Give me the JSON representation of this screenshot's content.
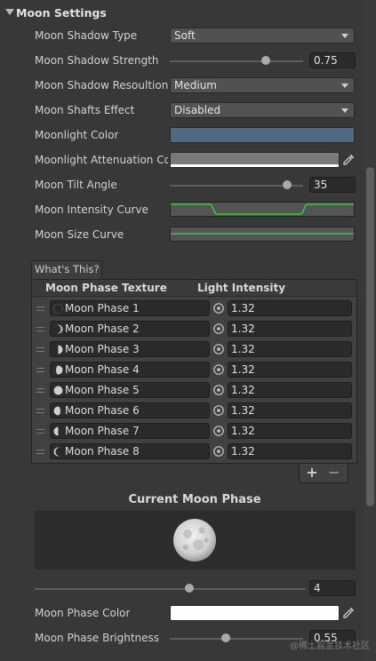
{
  "section": {
    "title": "Moon Settings"
  },
  "settings": {
    "shadow_type": {
      "label": "Moon Shadow Type",
      "value": "Soft"
    },
    "shadow_strength": {
      "label": "Moon Shadow Strength",
      "value": "0.75",
      "fraction": 0.75
    },
    "shadow_resolution": {
      "label": "Moon Shadow Resoultion",
      "value": "Medium"
    },
    "shafts_effect": {
      "label": "Moon Shafts Effect",
      "value": "Disabled"
    },
    "moonlight_color": {
      "label": "Moonlight Color",
      "color": "#4f6a80"
    },
    "attenuation_color": {
      "label": "Moonlight Attenuation Color",
      "color": "#7a7a7a"
    },
    "tilt_angle": {
      "label": "Moon Tilt Angle",
      "value": "35"
    },
    "intensity_curve": {
      "label": "Moon Intensity Curve",
      "curve_color": "#3fd23f"
    },
    "size_curve": {
      "label": "Moon Size Curve",
      "curve_color": "#3fd23f"
    }
  },
  "phases_list": {
    "tab_label": "What's This?",
    "columns": [
      "Moon Phase Texture",
      "Light Intensity"
    ],
    "rows": [
      {
        "texture": "Moon Phase 1",
        "intensity": "1.32",
        "lit": "new"
      },
      {
        "texture": "Moon Phase 2",
        "intensity": "1.32",
        "lit": "waxing-crescent"
      },
      {
        "texture": "Moon Phase 3",
        "intensity": "1.32",
        "lit": "first-quarter"
      },
      {
        "texture": "Moon Phase 4",
        "intensity": "1.32",
        "lit": "waxing-gibbous"
      },
      {
        "texture": "Moon Phase 5",
        "intensity": "1.32",
        "lit": "full"
      },
      {
        "texture": "Moon Phase 6",
        "intensity": "1.32",
        "lit": "waning-gibbous"
      },
      {
        "texture": "Moon Phase 7",
        "intensity": "1.32",
        "lit": "last-quarter"
      },
      {
        "texture": "Moon Phase 8",
        "intensity": "1.32",
        "lit": "waning-crescent"
      }
    ],
    "add_label": "+",
    "remove_label": "−"
  },
  "current_phase": {
    "title": "Current Moon Phase",
    "slider_value": "4",
    "slider_fraction": 0.5
  },
  "phase_color": {
    "label": "Moon Phase Color",
    "color": "#ffffff"
  },
  "phase_brightness": {
    "label": "Moon Phase Brightness",
    "value": "0.55",
    "fraction": 0.42
  },
  "watermark": "@稀土掘金技术社区",
  "colors": {
    "panel_bg": "#383838",
    "field_bg": "#2a2a2a",
    "dropdown_bg": "#515151",
    "curve_green": "#3fd23f"
  }
}
